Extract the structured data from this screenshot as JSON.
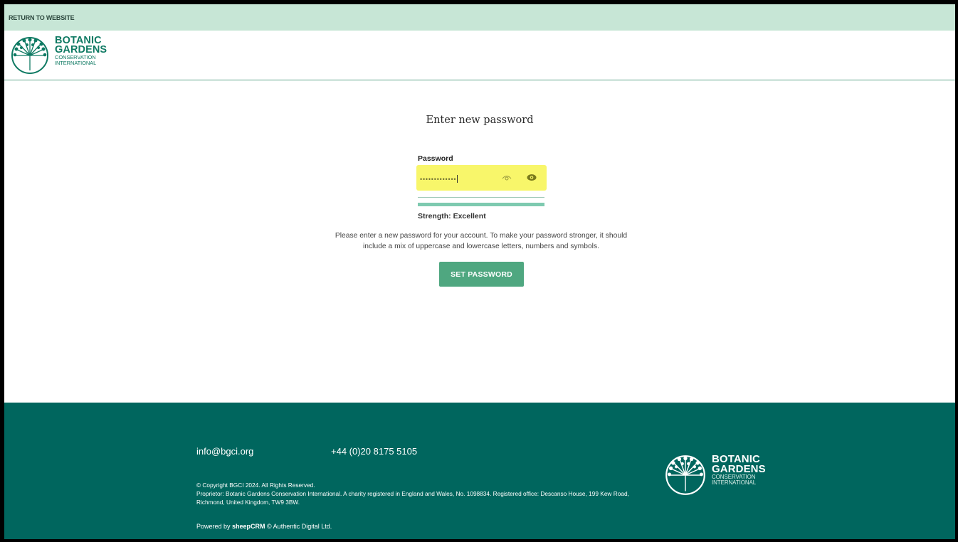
{
  "topbar": {
    "return_link": "RETURN TO WEBSITE"
  },
  "logo": {
    "line1": "BOTANIC",
    "line2": "GARDENS",
    "line3": "CONSERVATION",
    "line4": "INTERNATIONAL"
  },
  "form": {
    "title": "Enter new password",
    "password_label": "Password",
    "password_value": "•••••••••••••",
    "strength_text": "Strength: Excellent",
    "strength_level": 1.0,
    "help_text": "Please enter a new password for your account. To make your password stronger, it should include a mix of uppercase and lowercase letters, numbers and symbols.",
    "submit_label": "SET PASSWORD",
    "highlight_color": "#f8f66a"
  },
  "footer": {
    "email": "info@bgci.org",
    "phone": "+44 (0)20 8175 5105",
    "copyright": "© Copyright BGCI 2024. All Rights Reserved.",
    "proprietor": "Proprietor: Botanic Gardens Conservation International. A charity registered in England and Wales, No. 1098834. Registered office: Descanso House, 199 Kew Road, Richmond, United Kingdom, TW9 3BW.",
    "powered_prefix": "Powered by ",
    "powered_brand": "sheepCRM",
    "powered_suffix": " © Authentic Digital Ltd.",
    "background_color": "#00665e"
  },
  "colors": {
    "accent": "#4fa780",
    "brand": "#0f7a63",
    "topbar": "#c7e6d6"
  }
}
